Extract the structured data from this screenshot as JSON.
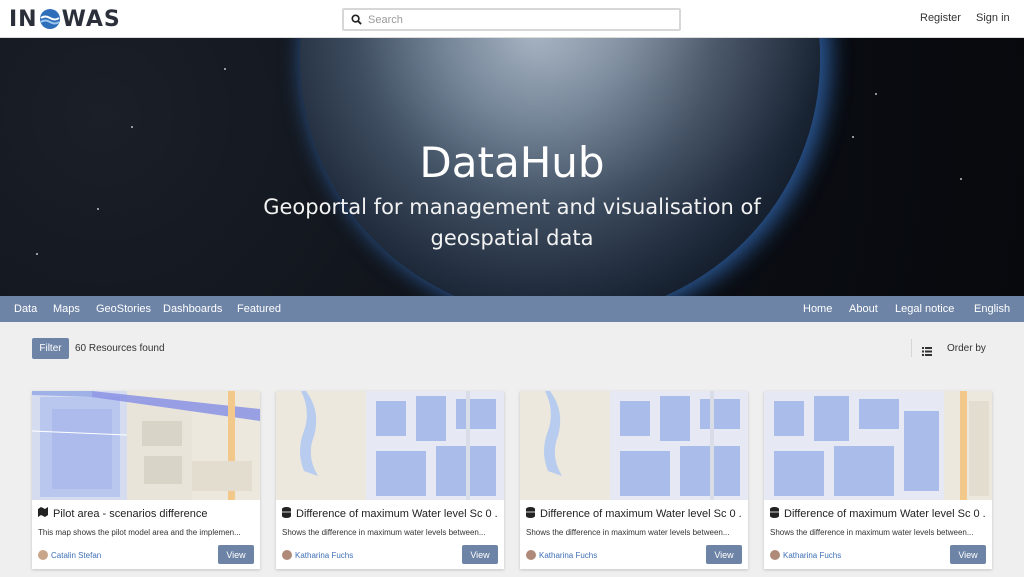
{
  "header": {
    "logo_text_left": "IN",
    "logo_text_right": "WAS",
    "search_placeholder": "Search",
    "register": "Register",
    "sign_in": "Sign in"
  },
  "hero": {
    "title": "DataHub",
    "subtitle": "Geoportal for management and visualisation of geospatial data"
  },
  "nav": {
    "left": [
      "Data",
      "Maps",
      "GeoStories",
      "Dashboards",
      "Featured"
    ],
    "right": [
      "Home",
      "About",
      "Legal notice",
      "English"
    ]
  },
  "toolbar": {
    "filter_label": "Filter",
    "resources_found": "60 Resources found",
    "order_by": "Order by"
  },
  "cards": [
    {
      "title": "Pilot area - scenarios difference",
      "type_icon": "map-icon",
      "description": "This map shows the pilot model area and the implemen...",
      "author": "Catalin Stefan",
      "view_label": "View"
    },
    {
      "title": "Difference of maximum Water level Sc 0 ...",
      "type_icon": "database-icon",
      "description": "Shows the difference in maximum water levels between...",
      "author": "Katharina Fuchs",
      "view_label": "View"
    },
    {
      "title": "Difference of maximum Water level Sc 0 ...",
      "type_icon": "database-icon",
      "description": "Shows the difference in maximum water levels between...",
      "author": "Katharina Fuchs",
      "view_label": "View"
    },
    {
      "title": "Difference of maximum Water level Sc 0 ...",
      "type_icon": "database-icon",
      "description": "Shows the difference in maximum water levels between...",
      "author": "Katharina Fuchs",
      "view_label": "View"
    }
  ],
  "colors": {
    "accent": "#6e84a6",
    "link": "#3d6fb6",
    "background": "#efefef"
  }
}
